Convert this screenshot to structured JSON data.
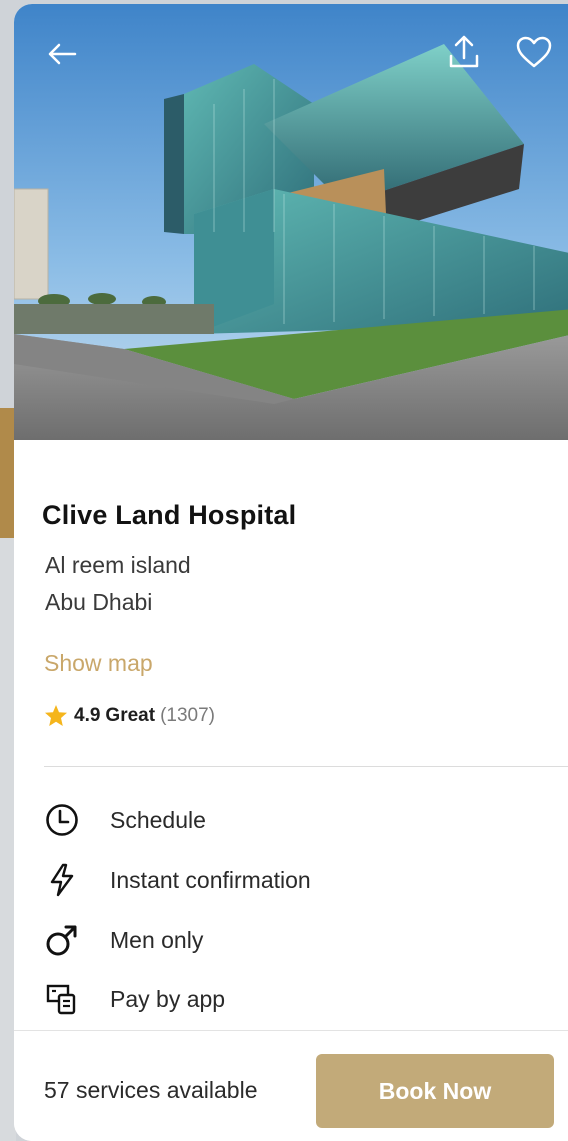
{
  "hospital": {
    "name": "Clive Land Hospital",
    "address_line1": "Al reem island",
    "address_line2": "Abu Dhabi",
    "show_map_label": "Show map",
    "rating": {
      "score": "4.9",
      "label": "Great",
      "count": "(1307)"
    }
  },
  "features": [
    {
      "icon": "clock-icon",
      "label": "Schedule"
    },
    {
      "icon": "lightning-icon",
      "label": "Instant confirmation"
    },
    {
      "icon": "male-symbol-icon",
      "label": "Men only"
    },
    {
      "icon": "pay-by-app-icon",
      "label": "Pay by app"
    }
  ],
  "footer": {
    "services_text": "57 services available",
    "book_label": "Book Now"
  },
  "colors": {
    "accent_gold": "#c2aa79",
    "link_gold": "#c9a76a",
    "star": "#f5b51c",
    "text_dark": "#121212"
  }
}
